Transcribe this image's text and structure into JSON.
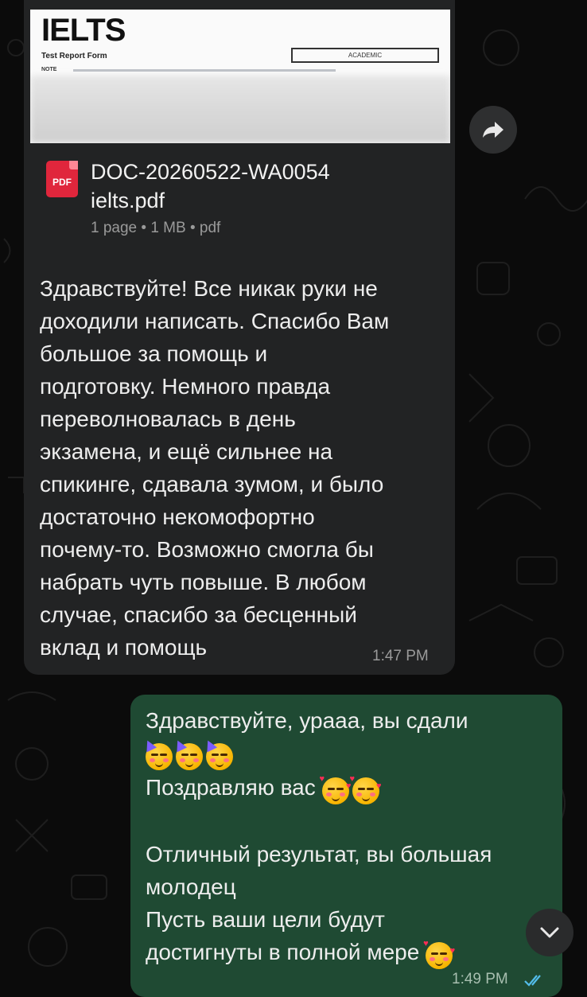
{
  "colors": {
    "background": "#0b0b0b",
    "incoming_bubble": "#222324",
    "outgoing_bubble": "#1f4a33",
    "pdf_red": "#e0263c",
    "read_ticks": "#53bdeb",
    "meta_text": "#9a9a9a"
  },
  "incoming": {
    "preview": {
      "logo": "IELTS",
      "form_title": "Test Report Form",
      "module": "ACADEMIC",
      "note_label": "NOTE"
    },
    "document": {
      "icon": "pdf-file-icon",
      "badge": "PDF",
      "name": "DOC-20260522-WA0054\nielts.pdf",
      "meta": "1 page • 1 MB • pdf"
    },
    "message": "Здравствуйте! Все никак руки не\nдоходили написать. Спасибо Вам\nбольшое за помощь и\nподготовку. Немного правда\nпереволновалась в день\nэкзамена, и ещё сильнее на\nспикинге, сдавала зумом, и было\nдостаточно некомофортно\nпочему-то. Возможно смогла бы\nнабрать чуть повыше. В любом\nслучае, спасибо за бесценный\nвклад и помощь",
    "time": "1:47 PM"
  },
  "outgoing": {
    "line1": "Здравствуйте, урааа, вы сдали",
    "line2_emojis": [
      "partying-face",
      "partying-face",
      "partying-face"
    ],
    "line3": "Поздравляю вас",
    "line3_emojis": [
      "smiling-face-with-hearts",
      "smiling-face-with-hearts"
    ],
    "line4": "Отличный результат, вы большая\nмолодец\nПусть ваши цели будут\nдостигнуты в полной мере",
    "line4_emojis": [
      "smiling-face-with-hearts"
    ],
    "time": "1:49 PM",
    "status": "read-double-check-icon"
  },
  "controls": {
    "forward": "forward-arrow-icon",
    "scroll_down": "chevron-down-icon"
  }
}
